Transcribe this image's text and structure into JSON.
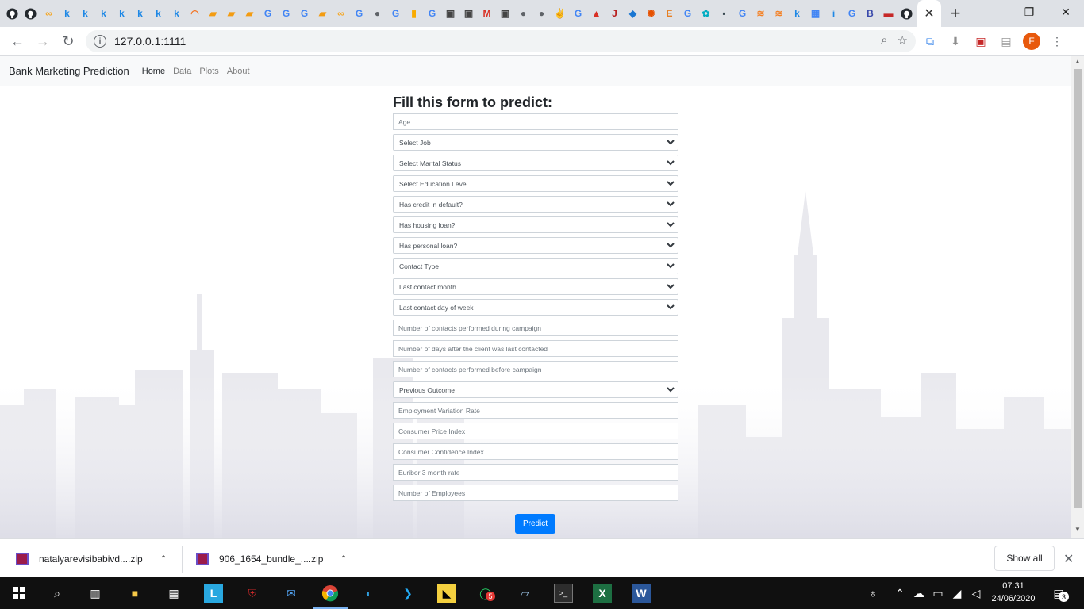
{
  "browser": {
    "url": "127.0.0.1:1111",
    "profile_initial": "F",
    "tab_close_glyph": "✕",
    "new_tab_glyph": "+"
  },
  "tab_favicons": [
    {
      "glyph": "",
      "color": "#24292e",
      "icon": "github-icon"
    },
    {
      "glyph": "",
      "color": "#24292e",
      "icon": "github-icon"
    },
    {
      "glyph": "∞",
      "color": "#f5a623",
      "icon": "infinity-icon"
    },
    {
      "glyph": "k",
      "color": "#1e88e5",
      "icon": "k-icon"
    },
    {
      "glyph": "k",
      "color": "#1e88e5",
      "icon": "k-icon"
    },
    {
      "glyph": "k",
      "color": "#1e88e5",
      "icon": "k-icon"
    },
    {
      "glyph": "k",
      "color": "#1e88e5",
      "icon": "k-icon"
    },
    {
      "glyph": "k",
      "color": "#1e88e5",
      "icon": "k-icon"
    },
    {
      "glyph": "k",
      "color": "#1e88e5",
      "icon": "k-icon"
    },
    {
      "glyph": "k",
      "color": "#1e88e5",
      "icon": "k-icon"
    },
    {
      "glyph": "◠",
      "color": "#f37626",
      "icon": "jupyter-icon"
    },
    {
      "glyph": "▰",
      "color": "#f39c12",
      "icon": "book-icon"
    },
    {
      "glyph": "▰",
      "color": "#f39c12",
      "icon": "book-icon"
    },
    {
      "glyph": "▰",
      "color": "#f39c12",
      "icon": "book-icon"
    },
    {
      "glyph": "G",
      "color": "#4285f4",
      "icon": "google-icon"
    },
    {
      "glyph": "G",
      "color": "#4285f4",
      "icon": "google-icon"
    },
    {
      "glyph": "G",
      "color": "#4285f4",
      "icon": "google-icon"
    },
    {
      "glyph": "▰",
      "color": "#f39c12",
      "icon": "book-icon"
    },
    {
      "glyph": "∞",
      "color": "#f5a623",
      "icon": "infinity-icon"
    },
    {
      "glyph": "G",
      "color": "#4285f4",
      "icon": "google-icon"
    },
    {
      "glyph": "●",
      "color": "#5f6368",
      "icon": "globe-icon"
    },
    {
      "glyph": "G",
      "color": "#4285f4",
      "icon": "google-icon"
    },
    {
      "glyph": "▮",
      "color": "#f9ab00",
      "icon": "analytics-icon"
    },
    {
      "glyph": "G",
      "color": "#4285f4",
      "icon": "google-icon"
    },
    {
      "glyph": "▣",
      "color": "#444",
      "icon": "scholar-icon"
    },
    {
      "glyph": "▣",
      "color": "#444",
      "icon": "scholar-icon"
    },
    {
      "glyph": "M",
      "color": "#d93025",
      "icon": "gmail-icon"
    },
    {
      "glyph": "▣",
      "color": "#444",
      "icon": "scholar-icon"
    },
    {
      "glyph": "●",
      "color": "#5f6368",
      "icon": "globe-icon"
    },
    {
      "glyph": "●",
      "color": "#5f6368",
      "icon": "globe-icon"
    },
    {
      "glyph": "✌",
      "color": "#333",
      "icon": "hand-icon"
    },
    {
      "glyph": "G",
      "color": "#4285f4",
      "icon": "google-icon"
    },
    {
      "glyph": "▲",
      "color": "#d93025",
      "icon": "arrow-icon"
    },
    {
      "glyph": "J",
      "color": "#b71c1c",
      "icon": "journal-icon"
    },
    {
      "glyph": "◆",
      "color": "#1976d2",
      "icon": "cap-icon"
    },
    {
      "glyph": "✺",
      "color": "#e65100",
      "icon": "sun-icon"
    },
    {
      "glyph": "E",
      "color": "#e67e22",
      "icon": "e-icon"
    },
    {
      "glyph": "G",
      "color": "#4285f4",
      "icon": "google-icon"
    },
    {
      "glyph": "✿",
      "color": "#00acc1",
      "icon": "flower-icon"
    },
    {
      "glyph": "▪",
      "color": "#37474f",
      "icon": "tds-icon"
    },
    {
      "glyph": "G",
      "color": "#4285f4",
      "icon": "google-icon"
    },
    {
      "glyph": "≋",
      "color": "#f48024",
      "icon": "stackoverflow-icon"
    },
    {
      "glyph": "≋",
      "color": "#f48024",
      "icon": "stackoverflow-icon"
    },
    {
      "glyph": "k",
      "color": "#1e88e5",
      "icon": "k-icon"
    },
    {
      "glyph": "▦",
      "color": "#4285f4",
      "icon": "translate-icon"
    },
    {
      "glyph": "i",
      "color": "#1e88e5",
      "icon": "info-icon"
    },
    {
      "glyph": "G",
      "color": "#4285f4",
      "icon": "google-icon"
    },
    {
      "glyph": "B",
      "color": "#3949ab",
      "icon": "b-icon"
    },
    {
      "glyph": "▬",
      "color": "#c62828",
      "icon": "swa-icon"
    },
    {
      "glyph": "",
      "color": "#24292e",
      "icon": "github-icon"
    }
  ],
  "navbar": {
    "brand": "Bank Marketing Prediction",
    "links": [
      "Home",
      "Data",
      "Plots",
      "About"
    ]
  },
  "form": {
    "title": "Fill this form to predict:",
    "fields": [
      {
        "type": "input",
        "placeholder": "Age"
      },
      {
        "type": "select",
        "label": "Select Job"
      },
      {
        "type": "select",
        "label": "Select Marital Status"
      },
      {
        "type": "select",
        "label": "Select Education Level"
      },
      {
        "type": "select",
        "label": "Has credit in default?"
      },
      {
        "type": "select",
        "label": "Has housing loan?"
      },
      {
        "type": "select",
        "label": "Has personal loan?"
      },
      {
        "type": "select",
        "label": "Contact Type"
      },
      {
        "type": "select",
        "label": "Last contact month"
      },
      {
        "type": "select",
        "label": "Last contact day of week"
      },
      {
        "type": "input",
        "placeholder": "Number of contacts performed during campaign"
      },
      {
        "type": "input",
        "placeholder": "Number of  days after the client was last contacted"
      },
      {
        "type": "input",
        "placeholder": "Number of contacts performed before campaign"
      },
      {
        "type": "select",
        "label": "Previous Outcome"
      },
      {
        "type": "input",
        "placeholder": "Employment Variation Rate"
      },
      {
        "type": "input",
        "placeholder": "Consumer Price Index"
      },
      {
        "type": "input",
        "placeholder": "Consumer Confidence Index"
      },
      {
        "type": "input",
        "placeholder": "Euribor 3 month rate"
      },
      {
        "type": "input",
        "placeholder": "Number of Employees"
      }
    ],
    "submit_label": "Predict",
    "submit_color": "#007bff"
  },
  "downloads": {
    "items": [
      {
        "name": "natalyarevisibabivd....zip"
      },
      {
        "name": "906_1654_bundle_....zip"
      }
    ],
    "show_all_label": "Show all"
  },
  "taskbar": {
    "time": "07:31",
    "date": "24/06/2020",
    "whatsapp_badge": "5",
    "notification_count": "3"
  }
}
